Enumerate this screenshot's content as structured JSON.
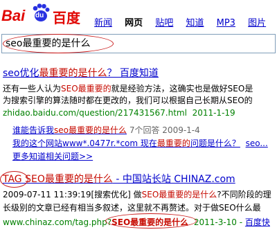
{
  "logo": {
    "latin": "Bai",
    "paw_text": "du",
    "cn": "百度"
  },
  "nav": {
    "items": [
      {
        "label": "新闻",
        "active": false
      },
      {
        "label": "网页",
        "active": true
      },
      {
        "label": "贴吧",
        "active": false
      },
      {
        "label": "知道",
        "active": false
      },
      {
        "label": "MP3",
        "active": false
      },
      {
        "label": "图片",
        "active": false
      },
      {
        "label": "视",
        "active": false
      }
    ]
  },
  "search": {
    "value": "seo最重要的是什么"
  },
  "results": [
    {
      "title_pre": "seo优化",
      "title_hl": "最重要的是什么",
      "title_post": "？ 百度知道",
      "snippet1_pre": "还有一些人认为",
      "snippet1_hl": "SEO最重要的",
      "snippet1_post": "就是经验方法，这确实也是做好SEO是",
      "snippet2": "为搜索引擎的算法随时都在更改的，我们可以根据自己长期从SEO的",
      "url": "zhidao.baidu.com/question/217431567.html",
      "date": "2011-1-19",
      "subs": [
        {
          "pre": "谁能告诉我",
          "hl": "seo最重要的是什么",
          "meta": "7个回答",
          "date": "2009-1-4"
        },
        {
          "pre": "我的这个网站www*.0477r.*com 现在",
          "hl": "最重要的",
          "post": "问题是什么？",
          "trail": "seo..."
        }
      ],
      "more": "更多知道相关问题>>"
    },
    {
      "tag": "TAG",
      "title_hl": "SEO最重要的是什么",
      "title_post": " - 中国站长站 CHINAZ.com",
      "snippet1_pre": "2009-07-11 11:39:19[搜索优化] 做",
      "snippet1_hl": "SEO最重要的是什么",
      "snippet1_post": "?不同阶段的理",
      "snippet2": "长级别的文章已经有相当多叙述，这里就不再赘述。对于做SEO什么最",
      "url_pre": "www.chinaz.com/tag.php?",
      "url_hl": "SEO最重要的是什么",
      "date": "2011-3-10",
      "cache": "百度快"
    }
  ]
}
